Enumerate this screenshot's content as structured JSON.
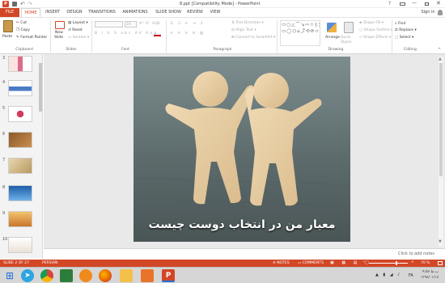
{
  "window": {
    "title": "8.ppt [Compatibility Mode] - PowerPoint",
    "help": "?",
    "sign_in": "Sign in"
  },
  "tabs": [
    "FILE",
    "HOME",
    "INSERT",
    "DESIGN",
    "TRANSITIONS",
    "ANIMATIONS",
    "SLIDE SHOW",
    "REVIEW",
    "VIEW"
  ],
  "active_tab": "HOME",
  "ribbon": {
    "clipboard": {
      "paste": "Paste",
      "cut": "Cut",
      "copy": "Copy",
      "format_painter": "Format Painter",
      "label": "Clipboard"
    },
    "slides": {
      "new_slide": "New",
      "new_slide2": "Slide",
      "layout": "Layout",
      "reset": "Reset",
      "section": "Section",
      "label": "Slides"
    },
    "font": {
      "size": "24",
      "label": "Font"
    },
    "paragraph": {
      "text_direction": "Text Direction",
      "align_text": "Align Text",
      "convert": "Convert to SmartArt",
      "label": "Paragraph"
    },
    "drawing": {
      "arrange": "Arrange",
      "quick_styles": "Quick Styles",
      "shape_fill": "Shape Fill",
      "shape_outline": "Shape Outline",
      "shape_effects": "Shape Effects",
      "label": "Drawing"
    },
    "editing": {
      "find": "Find",
      "replace": "Replace",
      "select": "Select",
      "label": "Editing"
    }
  },
  "thumbnails": [
    "3",
    "4",
    "5",
    "6",
    "7",
    "8",
    "9",
    "10"
  ],
  "slide": {
    "caption": "معیار من در انتخاب دوست چیست"
  },
  "notes": {
    "placeholder": "Click to add notes"
  },
  "status": {
    "slide_info": "SLIDE 2 OF 27",
    "language": "PERSIAN",
    "notes": "NOTES",
    "comments": "COMMENTS",
    "zoom": "70 %"
  },
  "taskbar": {
    "lang": "FA",
    "time": "۰۹:۵۷ ب.ظ",
    "date": "۱۳۹۸/۰۱/۱۷"
  },
  "colors": {
    "accent": "#d24726",
    "taskbar": "#d6d6d6"
  }
}
